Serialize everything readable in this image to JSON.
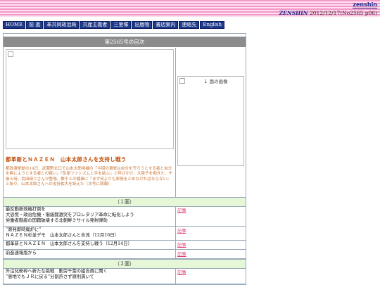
{
  "header": {
    "brand": "zenshin",
    "issue_prefix": "ZENSHIN",
    "issue_date": "2012/12/17(No2565 p06)"
  },
  "nav": [
    "HOME",
    "前 進",
    "革共同政治局",
    "共産主義者",
    "三里塚",
    "出版物",
    "書店案内",
    "連絡先",
    "English"
  ],
  "toc": {
    "heading": "第2565号の目次"
  },
  "lead": {
    "title": "都革新とＮＡＺＥＮ　山本太郎さんを支持し戦う",
    "body": "都政選挙動の14日、武蔵野北口で山本太郎候補の『今回の選挙は自分を守ろうとする者と自分を無にようとする者との戦い』『反原ファシズムと手を結ぶ』と呼びかけ、大阪子を抱ぎた、午後６時、武田研二さんが登場。数千人の聴衆に『まず何よりも原発をとめなければならない』と訴り、山本太郎さんへの支持拡大を訴えた（次号に続報）"
  },
  "side_image_caption": "１ 面の画像",
  "sections": [
    {
      "label": "（１面）",
      "rows": [
        {
          "lines": [
            "最反動新政権打倒を",
            "大恐慌・政治危機・階級闘激突をプロレタリア革命に転化しよう",
            "労働者階級の国籍破壊する北朝鮮ミサイル発射弾劾"
          ],
          "link": "記事"
        },
        {
          "lines": [
            "“原発即時廃炉に”",
            "ＮＡＺＥＮ杉並デモ　山本太郎さんと合流（12月16日）"
          ],
          "link": "記事"
        },
        {
          "lines": [
            "都革新とＮＡＺＥＮ　山本太郎さんを支持し戦う（12月14日）"
          ],
          "link": "記事"
        },
        {
          "lines": [
            "前進速報版から"
          ],
          "link": "記事"
        }
      ]
    },
    {
      "label": "（２面）",
      "rows": [
        {
          "lines": [
            "外注化粉砕へ新たな挑戦　動労千葉の組合員に聞く",
            "“意地でもＪＲに戻る”分割許さず原則貫いて"
          ],
          "link": "記事"
        }
      ]
    }
  ]
}
